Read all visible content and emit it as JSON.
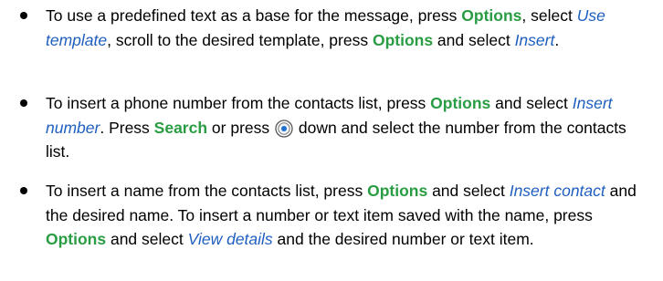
{
  "colors": {
    "keyword": "#2a9d44",
    "italic_term": "#1f5fbf",
    "text": "#000000"
  },
  "icons": {
    "nav_key": "scroll-key-icon"
  },
  "bullets": [
    {
      "t1": "To use a predefined text as a base for the message, press ",
      "k1": "Options",
      "t2": ", select ",
      "i1": "Use template",
      "t3": ", scroll to the desired template, press ",
      "k2": "Options",
      "t4": " and select ",
      "i2": "Insert",
      "t5": "."
    },
    {
      "t1": "To insert a phone number from the contacts list, press ",
      "k1": "Options",
      "t2": " and select ",
      "i1": "Insert number",
      "t3": ". Press ",
      "k2": "Search",
      "t4": " or press ",
      "t5": " down and select the number from the contacts list."
    },
    {
      "t1": "To insert a name from the contacts list, press ",
      "k1": "Options",
      "t2": " and select ",
      "i1": "Insert contact",
      "t3": " and the desired name. To insert a number or text item saved with the name, press ",
      "k2": "Options",
      "t4": " and select ",
      "i2": "View details",
      "t5": " and the desired number or text item."
    }
  ]
}
